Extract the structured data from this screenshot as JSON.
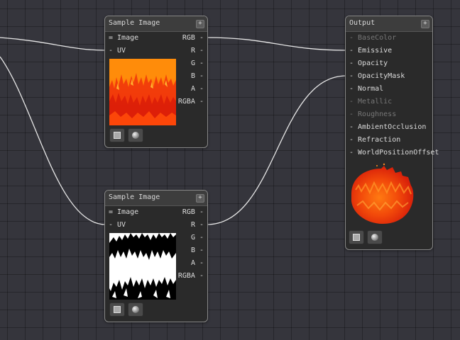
{
  "nodes": {
    "sample_top": {
      "title": "Sample Image",
      "collapse": "+",
      "inputs": [
        "= Image",
        "- UV"
      ],
      "outputs": [
        "RGB -",
        "R -",
        "G -",
        "B -",
        "A -",
        "RGBA -"
      ]
    },
    "sample_bottom": {
      "title": "Sample Image",
      "collapse": "+",
      "inputs": [
        "= Image",
        "- UV"
      ],
      "outputs": [
        "RGB -",
        "R -",
        "G -",
        "B -",
        "A -",
        "RGBA -"
      ]
    },
    "output": {
      "title": "Output",
      "collapse": "+",
      "inputs": [
        {
          "label": "- BaseColor",
          "enabled": false
        },
        {
          "label": "- Emissive",
          "enabled": true
        },
        {
          "label": "- Opacity",
          "enabled": true
        },
        {
          "label": "- OpacityMask",
          "enabled": true
        },
        {
          "label": "- Normal",
          "enabled": true
        },
        {
          "label": "- Metallic",
          "enabled": false
        },
        {
          "label": "- Roughness",
          "enabled": false
        },
        {
          "label": "- AmbientOcclusion",
          "enabled": true
        },
        {
          "label": "- Refraction",
          "enabled": true
        },
        {
          "label": "- WorldPositionOffset",
          "enabled": true
        }
      ]
    }
  },
  "colors": {
    "canvas": "#35353c",
    "node_body": "#2a2a2a",
    "node_header": "#3d3d3d",
    "wire": "#e6e6e6",
    "fire_orange": "#ff8c0a",
    "fire_red": "#e8200a",
    "mask_white": "#ffffff",
    "mask_black": "#000000"
  },
  "icons": [
    "square-preview-icon",
    "sphere-preview-icon",
    "collapse-plus-icon"
  ]
}
